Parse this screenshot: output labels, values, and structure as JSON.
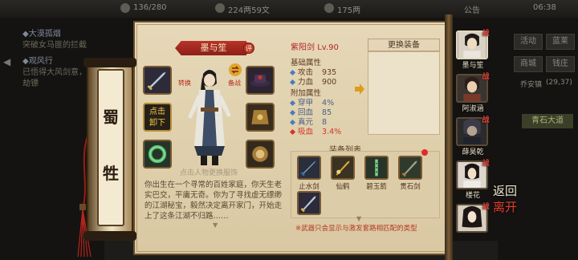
{
  "topbar": {
    "resource_1": "136/280",
    "resource_2": "224两59文",
    "resource_3": "175两",
    "announce": "公告",
    "time": "06:38"
  },
  "quests": [
    {
      "title": "◆大漠孤烟",
      "desc": "突破女马匪的拦截"
    },
    {
      "title": "◆观风行",
      "desc": "已悟得大风剑意，速去劫镖"
    }
  ],
  "bg_menu": {
    "btn_1": "活动",
    "btn_2": "蓝莱",
    "btn_3": "商城",
    "btn_4": "钱庄",
    "btn_5": "乔安镇",
    "coord": "(29,37)",
    "map_label": "青石大道"
  },
  "faction": {
    "char_1": "蜀",
    "char_2": "牲"
  },
  "character": {
    "name": "墨与笙",
    "review_label": "评",
    "unequip_line1": "点击",
    "unequip_line2": "卸下",
    "swap_label_left": "转换",
    "swap_label_right": "备战",
    "hint": "点击人物更换服饰",
    "bio": "你出生在一个寻常的百姓家庭，你天生老实巴交，平庸无奇。你为了寻找虚无缥缈的江湖秘宝，毅然决定离开家门，开始走上了这条江湖不归路……"
  },
  "weapon": {
    "name": "紫阳剑",
    "level": "Lv.90"
  },
  "attributes": {
    "base_title": "基础属性",
    "base": [
      {
        "label": "攻击",
        "value": "935"
      },
      {
        "label": "力血",
        "value": "900"
      }
    ],
    "extra_title": "附加属性",
    "extra": [
      {
        "label": "穿甲",
        "value": "4%",
        "color": "#4a7bbd"
      },
      {
        "label": "回血",
        "value": "85",
        "color": "#4a7bbd"
      },
      {
        "label": "真元",
        "value": "8",
        "color": "#4a7bbd"
      },
      {
        "label": "吸血",
        "value": "3.4%",
        "color": "#d0362b"
      }
    ]
  },
  "change_equip": {
    "title": "更换装备"
  },
  "equip_list": {
    "title": "装备列表",
    "items": [
      {
        "name": "止水剑"
      },
      {
        "name": "仙鹤"
      },
      {
        "name": "碧玉箭"
      },
      {
        "name": "贯石剑"
      },
      {
        "name": "紫阳剑"
      }
    ],
    "footnote": "※武器只会显示与激发套路相匹配的类型"
  },
  "roster": {
    "battle_tag": "战",
    "members": [
      {
        "name": "墨与笙"
      },
      {
        "name": "阿淑涵"
      },
      {
        "name": "薛昊乾"
      },
      {
        "name": "楼花"
      },
      {
        "name": ""
      }
    ]
  },
  "return_button": {
    "line1": "返回",
    "line2": "离开"
  },
  "colors": {
    "paper": "#e6d8b8",
    "accent_red": "#b2281f",
    "ribbon": "#b8332a",
    "attr_blue": "#4a7bbd",
    "frame_brown": "#6a4e2c"
  }
}
